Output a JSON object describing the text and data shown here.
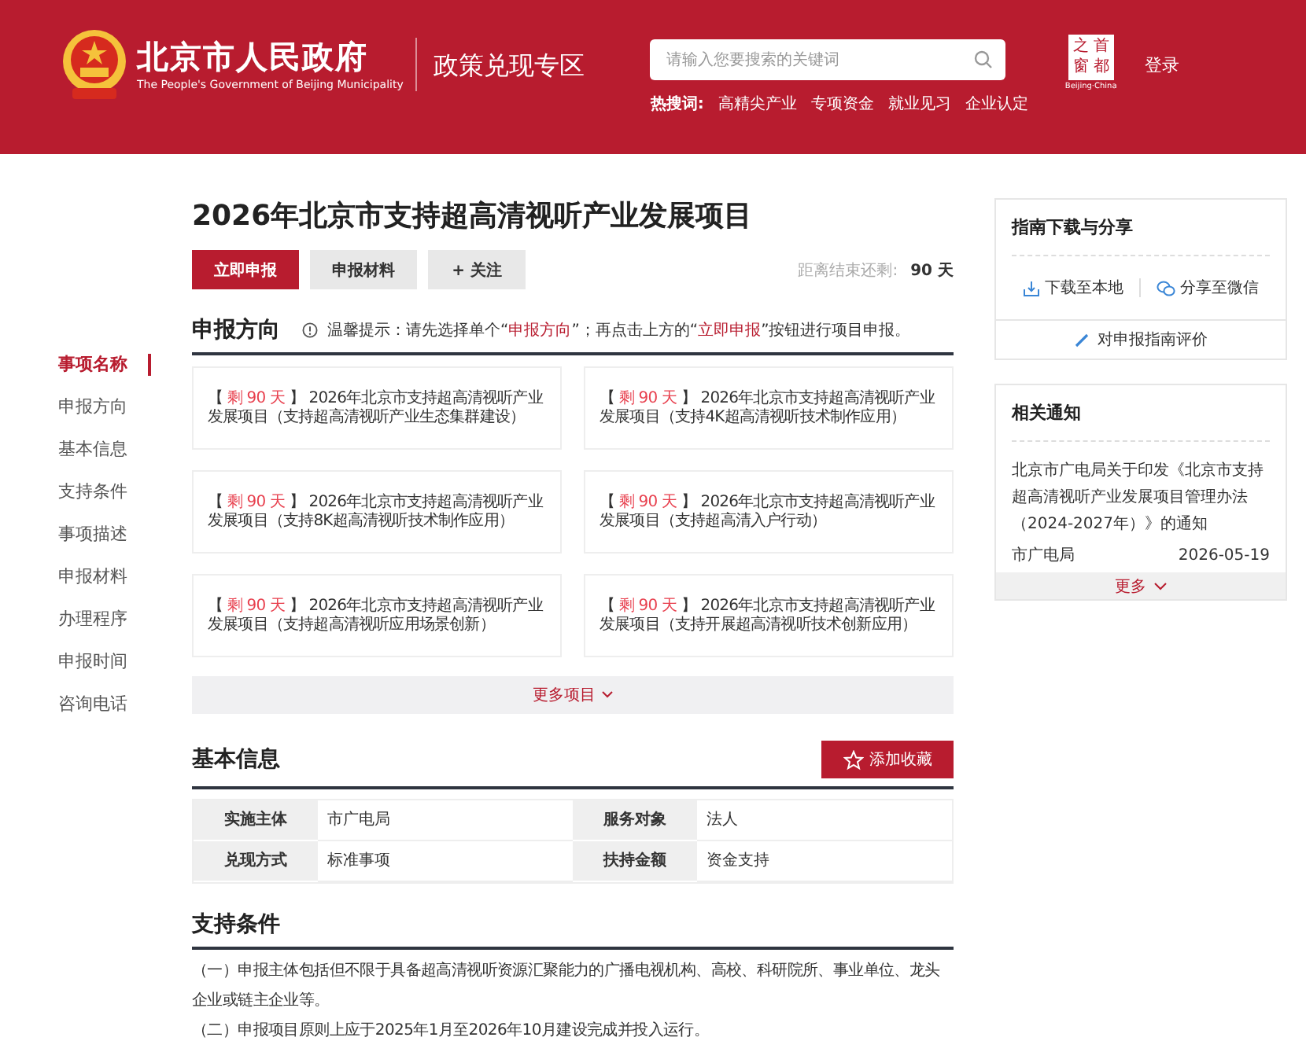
{
  "header": {
    "site_title": "北京市人民政府",
    "site_subtitle": "The People's Government of Beijing Municipality",
    "zone_title": "政策兑现专区",
    "search": {
      "placeholder": "请输入您要搜索的关键词"
    },
    "hot_label": "热搜词:",
    "hot_words": [
      "高精尖产业",
      "专项资金",
      "就业见习",
      "企业认定"
    ],
    "logo": {
      "chars": [
        "之",
        "首",
        "窗",
        "都"
      ],
      "caption": "Beijing·China"
    },
    "login": "登录"
  },
  "side_nav": [
    {
      "label": "事项名称",
      "selected": true
    },
    {
      "label": "申报方向",
      "selected": false
    },
    {
      "label": "基本信息",
      "selected": false
    },
    {
      "label": "支持条件",
      "selected": false
    },
    {
      "label": "事项描述",
      "selected": false
    },
    {
      "label": "申报材料",
      "selected": false
    },
    {
      "label": "办理程序",
      "selected": false
    },
    {
      "label": "申报时间",
      "selected": false
    },
    {
      "label": "咨询电话",
      "selected": false
    }
  ],
  "project": {
    "title": "2026年北京市支持超高清视听产业发展项目",
    "buttons": [
      {
        "label": "立即申报",
        "kind": "primary"
      },
      {
        "label": "申报材料",
        "kind": "secondary"
      },
      {
        "label": "+ 关注",
        "kind": "secondary"
      }
    ],
    "countdown_label": "距离结束还剩:",
    "countdown_value": "90 天"
  },
  "directions": {
    "title": "申报方向",
    "tip": "温馨提示：请先选择单个“**申报方向**”；再点击上方的“**立即申报**”按钮进行项目申报。",
    "items": [
      {
        "bracket_open": "【",
        "remaining": "剩 90 天",
        "bracket_close": "】",
        "text": "2026年北京市支持超高清视听产业发展项目（支持超高清视听产业生态集群建设）"
      },
      {
        "bracket_open": "【",
        "remaining": "剩 90 天",
        "bracket_close": "】",
        "text": "2026年北京市支持超高清视听产业发展项目（支持4K超高清视听技术制作应用）"
      },
      {
        "bracket_open": "【",
        "remaining": "剩 90 天",
        "bracket_close": "】",
        "text": "2026年北京市支持超高清视听产业发展项目（支持8K超高清视听技术制作应用）"
      },
      {
        "bracket_open": "【",
        "remaining": "剩 90 天",
        "bracket_close": "】",
        "text": "2026年北京市支持超高清视听产业发展项目（支持超高清入户行动）"
      },
      {
        "bracket_open": "【",
        "remaining": "剩 90 天",
        "bracket_close": "】",
        "text": "2026年北京市支持超高清视听产业发展项目（支持超高清视听应用场景创新）"
      },
      {
        "bracket_open": "【",
        "remaining": "剩 90 天",
        "bracket_close": "】",
        "text": "2026年北京市支持超高清视听产业发展项目（支持开展超高清视听技术创新应用）"
      }
    ],
    "more": "更多项目"
  },
  "basic_info": {
    "title": "基本信息",
    "favorite_button": "添加收藏",
    "rows": [
      [
        {
          "label": "实施主体",
          "value": "市广电局"
        },
        {
          "label": "服务对象",
          "value": "法人"
        }
      ],
      [
        {
          "label": "兑现方式",
          "value": "标准事项"
        },
        {
          "label": "扶持金额",
          "value": "资金支持"
        }
      ]
    ]
  },
  "conditions": {
    "title": "支持条件",
    "paragraphs": [
      "（一）申报主体包括但不限于具备超高清视听资源汇聚能力的广播电视机构、高校、科研院所、事业单位、龙头企业或链主企业等。",
      "（二）申报项目原则上应于2025年1月至2026年10月建设完成并投入运行。"
    ]
  },
  "guide": {
    "title": "指南下载与分享",
    "download": "下载至本地",
    "share": "分享至微信",
    "evaluate": "对申报指南评价"
  },
  "notices": {
    "title": "相关通知",
    "items": [
      {
        "title": "北京市广电局关于印发《北京市支持超高清视听产业发展项目管理办法（2024-2027年）》的通知",
        "source": "市广电局",
        "date": "2026-05-19"
      }
    ],
    "more": "更多"
  }
}
